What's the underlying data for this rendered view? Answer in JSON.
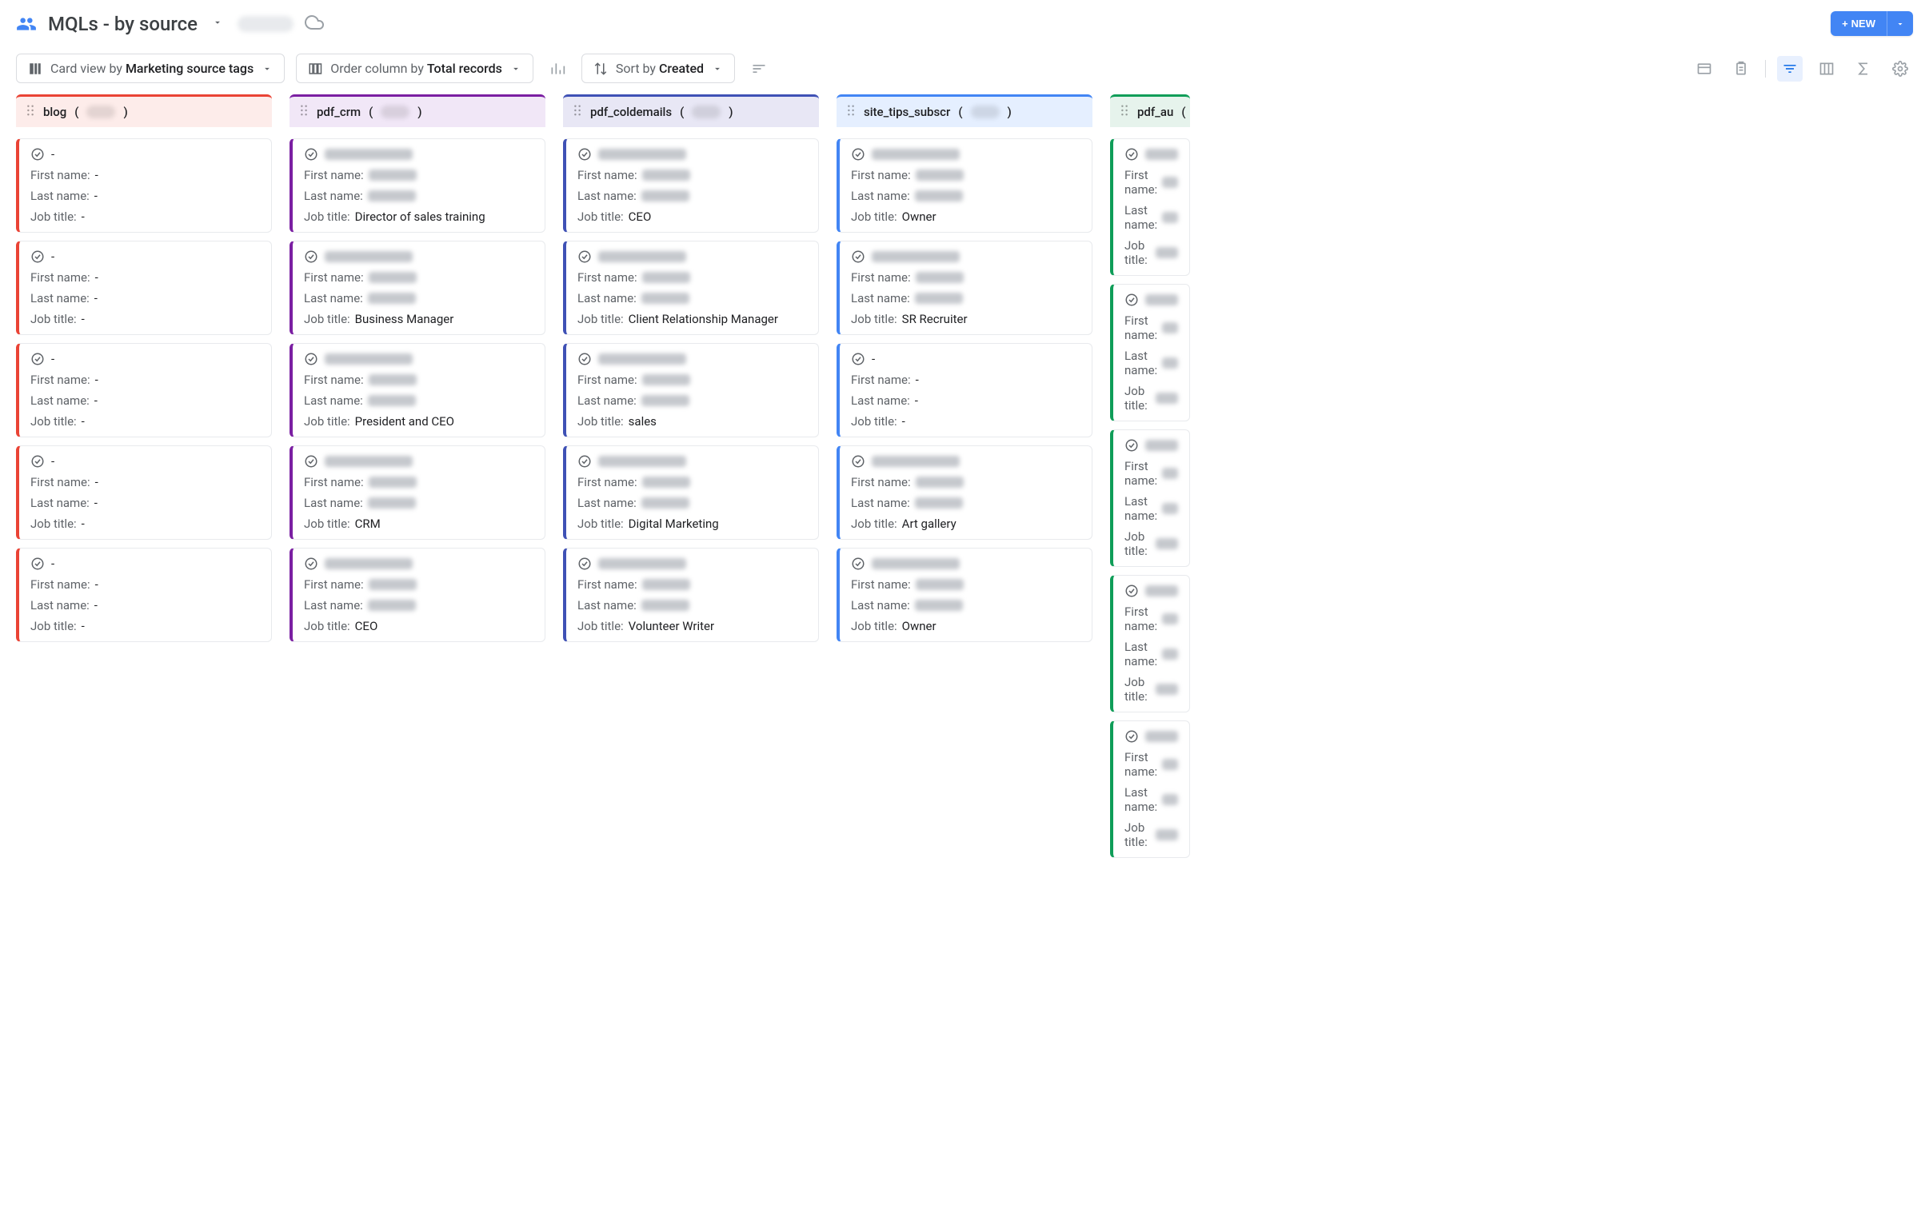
{
  "header": {
    "title": "MQLs - by source",
    "new_label": "NEW"
  },
  "toolbar": {
    "card_view_prefix": "Card view by",
    "card_view_value": "Marketing source tags",
    "order_prefix": "Order column by",
    "order_value": "Total records",
    "sort_prefix": "Sort by",
    "sort_value": "Created"
  },
  "labels": {
    "first_name": "First name:",
    "last_name": "Last name:",
    "job_title": "Job title:"
  },
  "columns": [
    {
      "id": "blog",
      "label": "blog",
      "header_class": "col-blog",
      "stripe_class": "stripe-blog",
      "cards": [
        {
          "title_hidden": false,
          "title": "-",
          "first_hidden": false,
          "first": "-",
          "last_hidden": false,
          "last": "-",
          "job_hidden": false,
          "job": "-"
        },
        {
          "title_hidden": false,
          "title": "-",
          "first_hidden": false,
          "first": "-",
          "last_hidden": false,
          "last": "-",
          "job_hidden": false,
          "job": "-"
        },
        {
          "title_hidden": false,
          "title": "-",
          "first_hidden": false,
          "first": "-",
          "last_hidden": false,
          "last": "-",
          "job_hidden": false,
          "job": "-"
        },
        {
          "title_hidden": false,
          "title": "-",
          "first_hidden": false,
          "first": "-",
          "last_hidden": false,
          "last": "-",
          "job_hidden": false,
          "job": "-"
        },
        {
          "title_hidden": false,
          "title": "-",
          "first_hidden": false,
          "first": "-",
          "last_hidden": false,
          "last": "-",
          "job_hidden": false,
          "job": "-"
        }
      ]
    },
    {
      "id": "pdf_crm",
      "label": "pdf_crm",
      "header_class": "col-crm",
      "stripe_class": "stripe-crm",
      "cards": [
        {
          "title_hidden": true,
          "first_hidden": true,
          "last_hidden": true,
          "job_hidden": false,
          "job": "Director of sales training"
        },
        {
          "title_hidden": true,
          "first_hidden": true,
          "last_hidden": true,
          "job_hidden": false,
          "job": "Business Manager"
        },
        {
          "title_hidden": true,
          "first_hidden": true,
          "last_hidden": true,
          "job_hidden": false,
          "job": "President and CEO"
        },
        {
          "title_hidden": true,
          "first_hidden": true,
          "last_hidden": true,
          "job_hidden": false,
          "job": "CRM"
        },
        {
          "title_hidden": true,
          "first_hidden": true,
          "last_hidden": true,
          "job_hidden": false,
          "job": "CEO"
        }
      ]
    },
    {
      "id": "pdf_coldemails",
      "label": "pdf_coldemails",
      "header_class": "col-cold",
      "stripe_class": "stripe-cold",
      "cards": [
        {
          "title_hidden": true,
          "first_hidden": true,
          "last_hidden": true,
          "job_hidden": false,
          "job": "CEO"
        },
        {
          "title_hidden": true,
          "first_hidden": true,
          "last_hidden": true,
          "job_hidden": false,
          "job": "Client Relationship Manager"
        },
        {
          "title_hidden": true,
          "first_hidden": true,
          "last_hidden": true,
          "job_hidden": false,
          "job": "sales"
        },
        {
          "title_hidden": true,
          "first_hidden": true,
          "last_hidden": true,
          "job_hidden": false,
          "job": "Digital Marketing"
        },
        {
          "title_hidden": true,
          "first_hidden": true,
          "last_hidden": true,
          "job_hidden": false,
          "job": "Volunteer Writer"
        }
      ]
    },
    {
      "id": "site_tips_subscr",
      "label": "site_tips_subscr",
      "header_class": "col-tips",
      "stripe_class": "stripe-tips",
      "cards": [
        {
          "title_hidden": true,
          "first_hidden": true,
          "last_hidden": true,
          "job_hidden": false,
          "job": "Owner"
        },
        {
          "title_hidden": true,
          "first_hidden": true,
          "last_hidden": true,
          "job_hidden": false,
          "job": "SR Recruiter"
        },
        {
          "title_hidden": false,
          "title": "-",
          "first_hidden": false,
          "first": "-",
          "last_hidden": false,
          "last": "-",
          "job_hidden": false,
          "job": "-"
        },
        {
          "title_hidden": true,
          "first_hidden": true,
          "last_hidden": true,
          "job_hidden": false,
          "job": "Art gallery"
        },
        {
          "title_hidden": true,
          "first_hidden": true,
          "last_hidden": true,
          "job_hidden": false,
          "job": "Owner"
        }
      ]
    },
    {
      "id": "pdf_au",
      "label": "pdf_au",
      "header_class": "col-au",
      "stripe_class": "stripe-au",
      "cut": true,
      "cards": [
        {
          "title_hidden": true,
          "first_hidden": true,
          "last_hidden": true,
          "job_hidden": true
        },
        {
          "title_hidden": true,
          "first_hidden": true,
          "last_hidden": true,
          "job_hidden": true
        },
        {
          "title_hidden": true,
          "first_hidden": true,
          "last_hidden": true,
          "job_hidden": true
        },
        {
          "title_hidden": true,
          "first_hidden": true,
          "last_hidden": true,
          "job_hidden": true
        },
        {
          "title_hidden": true,
          "first_hidden": true,
          "last_hidden": true,
          "job_hidden": true
        }
      ]
    }
  ]
}
